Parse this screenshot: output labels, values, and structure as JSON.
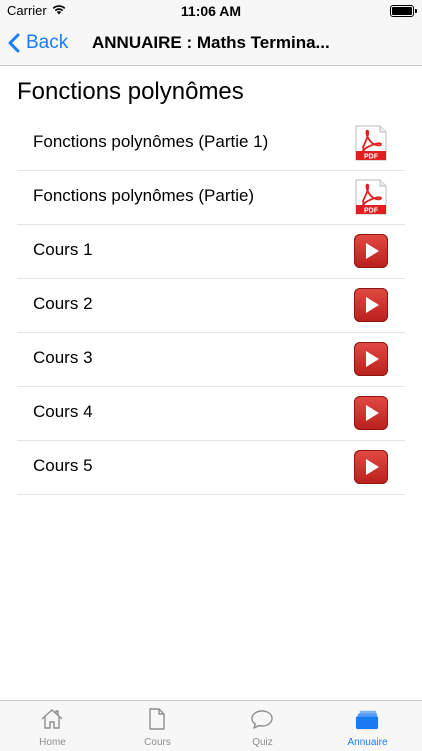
{
  "status_bar": {
    "carrier": "Carrier",
    "time": "11:06 AM"
  },
  "nav": {
    "back_label": "Back",
    "title": "ANNUAIRE : Maths Termina..."
  },
  "section": {
    "title": "Fonctions polynômes"
  },
  "items": [
    {
      "label": "Fonctions polynômes (Partie 1)",
      "icon": "pdf-icon"
    },
    {
      "label": "Fonctions polynômes (Partie)",
      "icon": "pdf-icon"
    },
    {
      "label": "Cours 1",
      "icon": "play-icon"
    },
    {
      "label": "Cours 2",
      "icon": "play-icon"
    },
    {
      "label": "Cours 3",
      "icon": "play-icon"
    },
    {
      "label": "Cours 4",
      "icon": "play-icon"
    },
    {
      "label": "Cours 5",
      "icon": "play-icon"
    }
  ],
  "tabs": [
    {
      "label": "Home",
      "icon": "home-icon",
      "active": false
    },
    {
      "label": "Cours",
      "icon": "document-icon",
      "active": false
    },
    {
      "label": "Quiz",
      "icon": "chat-bubble-icon",
      "active": false
    },
    {
      "label": "Annuaire",
      "icon": "folder-stack-icon",
      "active": true
    }
  ],
  "pdf_badge": "PDF",
  "colors": {
    "accent": "#1a7cf5",
    "play": "#c4302b",
    "pdf": "#e02020"
  }
}
